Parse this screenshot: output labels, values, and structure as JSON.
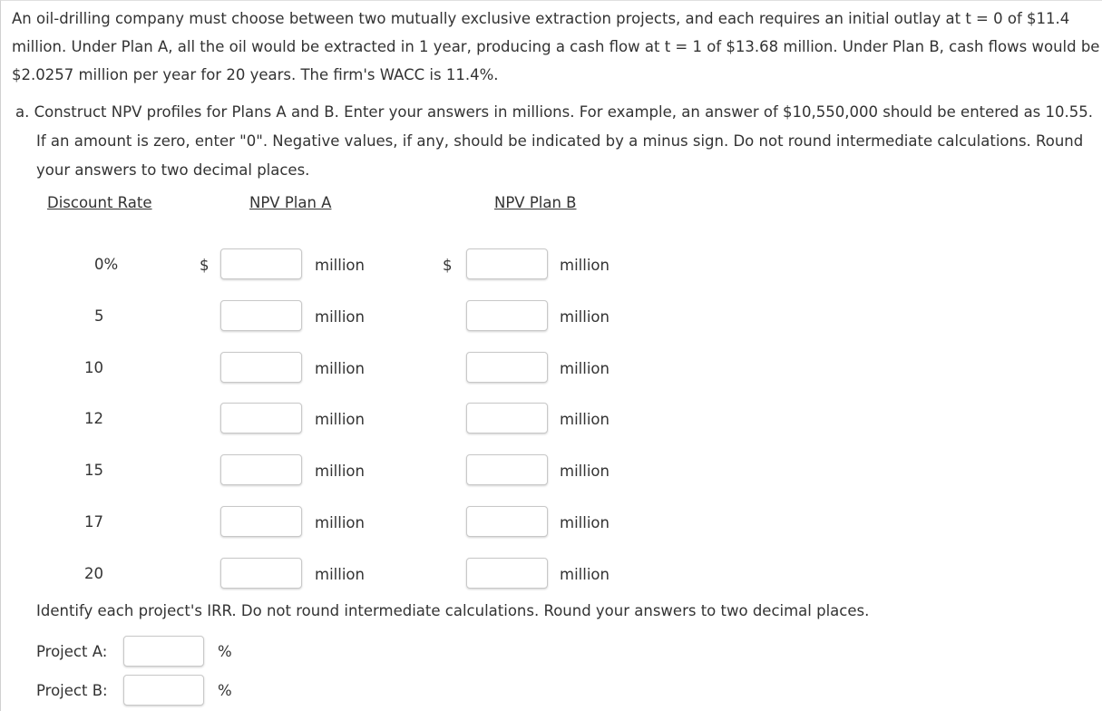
{
  "problem": {
    "intro": "An oil-drilling company must choose between two mutually exclusive extraction projects, and each requires an initial outlay at t = 0 of $11.4 million. Under Plan A, all the oil would be extracted in 1 year, producing a cash flow at t = 1 of $13.68 million. Under Plan B, cash flows would be $2.0257 million per year for 20 years. The firm's WACC is 11.4%.",
    "part_a_label": "a.",
    "part_a_text": "Construct NPV profiles for Plans A and B. Enter your answers in millions. For example, an answer of $10,550,000 should be entered as 10.55. If an amount is zero, enter \"0\". Negative values, if any, should be indicated by a minus sign. Do not round intermediate calculations. Round your answers to two decimal places."
  },
  "table": {
    "headers": {
      "rate": "Discount Rate",
      "plan_a": "NPV Plan A",
      "plan_b": "NPV Plan B"
    },
    "currency_symbol": "$",
    "unit": "million",
    "rows": [
      {
        "rate": "0%",
        "plan_a_value": "",
        "plan_b_value": "",
        "show_dollar": true
      },
      {
        "rate": "5",
        "plan_a_value": "",
        "plan_b_value": ""
      },
      {
        "rate": "10",
        "plan_a_value": "",
        "plan_b_value": ""
      },
      {
        "rate": "12",
        "plan_a_value": "",
        "plan_b_value": ""
      },
      {
        "rate": "15",
        "plan_a_value": "",
        "plan_b_value": ""
      },
      {
        "rate": "17",
        "plan_a_value": "",
        "plan_b_value": ""
      },
      {
        "rate": "20",
        "plan_a_value": "",
        "plan_b_value": ""
      }
    ]
  },
  "irr": {
    "prompt": "Identify each project's IRR. Do not round intermediate calculations. Round your answers to two decimal places.",
    "percent_symbol": "%",
    "projects": [
      {
        "label": "Project A:",
        "value": ""
      },
      {
        "label": "Project B:",
        "value": ""
      }
    ]
  }
}
